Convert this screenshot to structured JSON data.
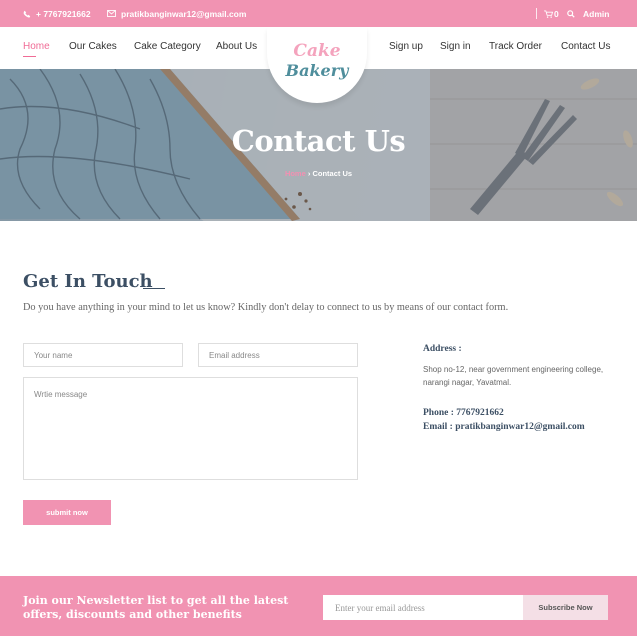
{
  "topbar": {
    "phone": "+ 7767921662",
    "email": "pratikbanginwar12@gmail.com",
    "cart_count": "0",
    "user": "Admin"
  },
  "nav": {
    "left": [
      "Home",
      "Our Cakes",
      "Cake Category",
      "About Us"
    ],
    "right": [
      "Sign up",
      "Sign in",
      "Track Order",
      "Contact Us"
    ],
    "active": "Home"
  },
  "logo": {
    "line1": "Cake",
    "line2": "Bakery"
  },
  "hero": {
    "title": "Contact Us",
    "crumb_home": "Home",
    "crumb_sep": "›",
    "crumb_current": "Contact Us"
  },
  "contact": {
    "title": "Get In Touch",
    "description": "Do you have anything in your mind to let us know? Kindly don't delay to connect to us by means of our contact form.",
    "name_placeholder": "Your name",
    "email_placeholder": "Email address",
    "message_placeholder": "Wrtie message",
    "submit_label": "submit now"
  },
  "info": {
    "address_label": "Address :",
    "address": "Shop no-12, near government engineering college, narangi nagar, Yavatmal.",
    "phone": "Phone : 7767921662",
    "email": "Email : pratikbanginwar12@gmail.com"
  },
  "newsletter": {
    "title": "Join our Newsletter list to get all the latest offers, discounts and other benefits",
    "placeholder": "Enter your email address",
    "button": "Subscribe Now"
  },
  "colors": {
    "accent": "#f193b2",
    "heading": "#3c4f64",
    "logo_pink": "#f4a3bd",
    "logo_teal": "#4f8e9c"
  }
}
